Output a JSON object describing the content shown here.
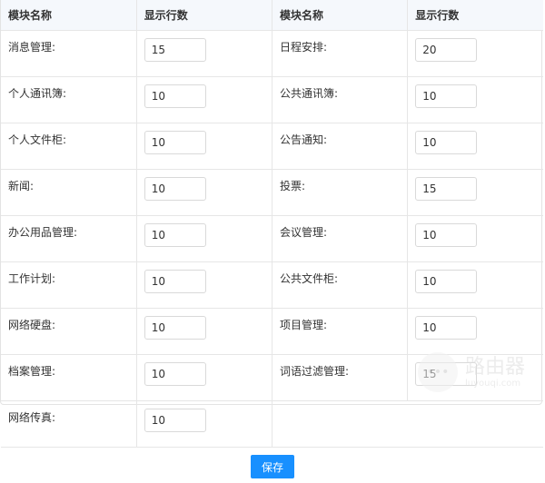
{
  "headers": [
    "模块名称",
    "显示行数",
    "模块名称",
    "显示行数"
  ],
  "rows": [
    [
      {
        "label": "消息管理:",
        "value": "15"
      },
      {
        "label": "日程安排:",
        "value": "20"
      }
    ],
    [
      {
        "label": "个人通讯簿:",
        "value": "10"
      },
      {
        "label": "公共通讯簿:",
        "value": "10"
      }
    ],
    [
      {
        "label": "个人文件柜:",
        "value": "10"
      },
      {
        "label": "公告通知:",
        "value": "10"
      }
    ],
    [
      {
        "label": "新闻:",
        "value": "10"
      },
      {
        "label": "投票:",
        "value": "15"
      }
    ],
    [
      {
        "label": "办公用品管理:",
        "value": "10"
      },
      {
        "label": "会议管理:",
        "value": "10"
      }
    ],
    [
      {
        "label": "工作计划:",
        "value": "10"
      },
      {
        "label": "公共文件柜:",
        "value": "10"
      }
    ],
    [
      {
        "label": "网络硬盘:",
        "value": "10"
      },
      {
        "label": "项目管理:",
        "value": "10"
      }
    ],
    [
      {
        "label": "档案管理:",
        "value": "10"
      },
      {
        "label": "词语过滤管理:",
        "value": "15"
      }
    ],
    [
      {
        "label": "网络传真:",
        "value": "10"
      }
    ]
  ],
  "save_label": "保存",
  "watermark": {
    "title": "路由器",
    "sub": "luyouqi.com"
  }
}
